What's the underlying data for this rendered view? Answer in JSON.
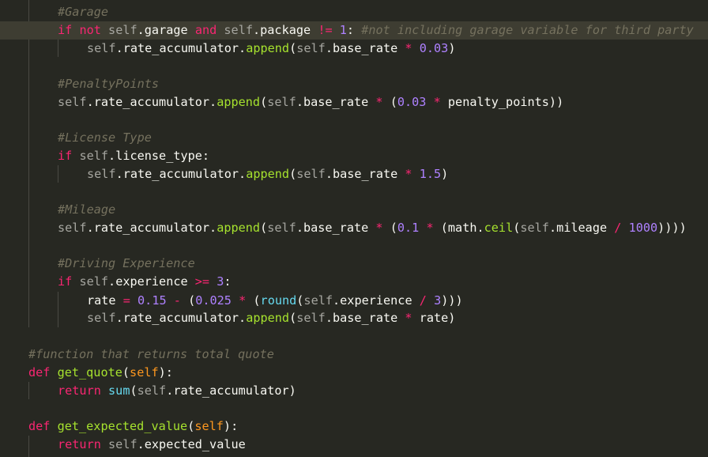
{
  "editor": {
    "theme": {
      "background": "#272822",
      "active_line": "#3e3d32",
      "comment": "#75715e",
      "keyword": "#f92672",
      "function": "#a6e22e",
      "number": "#ae81ff"
    },
    "lines": [
      {
        "tokens": [
          [
            "comment",
            "#Garage"
          ]
        ]
      },
      {
        "tokens": [
          [
            "kw",
            "if"
          ],
          [
            "punc",
            " "
          ],
          [
            "kw",
            "not"
          ],
          [
            "punc",
            " "
          ],
          [
            "self",
            "self"
          ],
          [
            "punc",
            "."
          ],
          [
            "attr",
            "garage"
          ],
          [
            "punc",
            " "
          ],
          [
            "kw",
            "and"
          ],
          [
            "punc",
            " "
          ],
          [
            "self",
            "self"
          ],
          [
            "punc",
            "."
          ],
          [
            "attr",
            "package"
          ],
          [
            "punc",
            " "
          ],
          [
            "op",
            "!="
          ],
          [
            "punc",
            " "
          ],
          [
            "num",
            "1"
          ],
          [
            "punc",
            ": "
          ],
          [
            "comment",
            "#not including garage variable for third party"
          ]
        ]
      },
      {
        "tokens": [
          [
            "self",
            "self"
          ],
          [
            "punc",
            "."
          ],
          [
            "attr",
            "rate_accumulator"
          ],
          [
            "punc",
            "."
          ],
          [
            "fn",
            "append"
          ],
          [
            "punc",
            "("
          ],
          [
            "self",
            "self"
          ],
          [
            "punc",
            "."
          ],
          [
            "attr",
            "base_rate"
          ],
          [
            "punc",
            " "
          ],
          [
            "op",
            "*"
          ],
          [
            "punc",
            " "
          ],
          [
            "num",
            "0.03"
          ],
          [
            "punc",
            ")"
          ]
        ]
      },
      {
        "tokens": []
      },
      {
        "tokens": [
          [
            "comment",
            "#PenaltyPoints"
          ]
        ]
      },
      {
        "tokens": [
          [
            "self",
            "self"
          ],
          [
            "punc",
            "."
          ],
          [
            "attr",
            "rate_accumulator"
          ],
          [
            "punc",
            "."
          ],
          [
            "fn",
            "append"
          ],
          [
            "punc",
            "("
          ],
          [
            "self",
            "self"
          ],
          [
            "punc",
            "."
          ],
          [
            "attr",
            "base_rate"
          ],
          [
            "punc",
            " "
          ],
          [
            "op",
            "*"
          ],
          [
            "punc",
            " ("
          ],
          [
            "num",
            "0.03"
          ],
          [
            "punc",
            " "
          ],
          [
            "op",
            "*"
          ],
          [
            "punc",
            " penalty_points))"
          ]
        ]
      },
      {
        "tokens": []
      },
      {
        "tokens": [
          [
            "comment",
            "#License Type"
          ]
        ]
      },
      {
        "tokens": [
          [
            "kw",
            "if"
          ],
          [
            "punc",
            " "
          ],
          [
            "self",
            "self"
          ],
          [
            "punc",
            "."
          ],
          [
            "attr",
            "license_type"
          ],
          [
            "punc",
            ":"
          ]
        ]
      },
      {
        "tokens": [
          [
            "self",
            "self"
          ],
          [
            "punc",
            "."
          ],
          [
            "attr",
            "rate_accumulator"
          ],
          [
            "punc",
            "."
          ],
          [
            "fn",
            "append"
          ],
          [
            "punc",
            "("
          ],
          [
            "self",
            "self"
          ],
          [
            "punc",
            "."
          ],
          [
            "attr",
            "base_rate"
          ],
          [
            "punc",
            " "
          ],
          [
            "op",
            "*"
          ],
          [
            "punc",
            " "
          ],
          [
            "num",
            "1.5"
          ],
          [
            "punc",
            ")"
          ]
        ]
      },
      {
        "tokens": []
      },
      {
        "tokens": [
          [
            "comment",
            "#Mileage"
          ]
        ]
      },
      {
        "tokens": [
          [
            "self",
            "self"
          ],
          [
            "punc",
            "."
          ],
          [
            "attr",
            "rate_accumulator"
          ],
          [
            "punc",
            "."
          ],
          [
            "fn",
            "append"
          ],
          [
            "punc",
            "("
          ],
          [
            "self",
            "self"
          ],
          [
            "punc",
            "."
          ],
          [
            "attr",
            "base_rate"
          ],
          [
            "punc",
            " "
          ],
          [
            "op",
            "*"
          ],
          [
            "punc",
            " ("
          ],
          [
            "num",
            "0.1"
          ],
          [
            "punc",
            " "
          ],
          [
            "op",
            "*"
          ],
          [
            "punc",
            " (math."
          ],
          [
            "fn",
            "ceil"
          ],
          [
            "punc",
            "("
          ],
          [
            "self",
            "self"
          ],
          [
            "punc",
            "."
          ],
          [
            "attr",
            "mileage"
          ],
          [
            "punc",
            " "
          ],
          [
            "op",
            "/"
          ],
          [
            "punc",
            " "
          ],
          [
            "num",
            "1000"
          ],
          [
            "punc",
            "))))"
          ]
        ]
      },
      {
        "tokens": []
      },
      {
        "tokens": [
          [
            "comment",
            "#Driving Experience"
          ]
        ]
      },
      {
        "tokens": [
          [
            "kw",
            "if"
          ],
          [
            "punc",
            " "
          ],
          [
            "self",
            "self"
          ],
          [
            "punc",
            "."
          ],
          [
            "attr",
            "experience"
          ],
          [
            "punc",
            " "
          ],
          [
            "op",
            ">="
          ],
          [
            "punc",
            " "
          ],
          [
            "num",
            "3"
          ],
          [
            "punc",
            ":"
          ]
        ]
      },
      {
        "tokens": [
          [
            "punc",
            "rate "
          ],
          [
            "op",
            "="
          ],
          [
            "punc",
            " "
          ],
          [
            "num",
            "0.15"
          ],
          [
            "punc",
            " "
          ],
          [
            "op",
            "-"
          ],
          [
            "punc",
            " ("
          ],
          [
            "num",
            "0.025"
          ],
          [
            "punc",
            " "
          ],
          [
            "op",
            "*"
          ],
          [
            "punc",
            " ("
          ],
          [
            "builtin",
            "round"
          ],
          [
            "punc",
            "("
          ],
          [
            "self",
            "self"
          ],
          [
            "punc",
            "."
          ],
          [
            "attr",
            "experience"
          ],
          [
            "punc",
            " "
          ],
          [
            "op",
            "/"
          ],
          [
            "punc",
            " "
          ],
          [
            "num",
            "3"
          ],
          [
            "punc",
            ")))"
          ]
        ]
      },
      {
        "tokens": [
          [
            "self",
            "self"
          ],
          [
            "punc",
            "."
          ],
          [
            "attr",
            "rate_accumulator"
          ],
          [
            "punc",
            "."
          ],
          [
            "fn",
            "append"
          ],
          [
            "punc",
            "("
          ],
          [
            "self",
            "self"
          ],
          [
            "punc",
            "."
          ],
          [
            "attr",
            "base_rate"
          ],
          [
            "punc",
            " "
          ],
          [
            "op",
            "*"
          ],
          [
            "punc",
            " rate)"
          ]
        ]
      },
      {
        "tokens": []
      },
      {
        "tokens": [
          [
            "comment",
            "#function that returns total quote"
          ]
        ]
      },
      {
        "tokens": [
          [
            "kw",
            "def"
          ],
          [
            "punc",
            " "
          ],
          [
            "fn",
            "get_quote"
          ],
          [
            "punc",
            "("
          ],
          [
            "param",
            "self"
          ],
          [
            "punc",
            "):"
          ]
        ]
      },
      {
        "tokens": [
          [
            "kw",
            "return"
          ],
          [
            "punc",
            " "
          ],
          [
            "builtin",
            "sum"
          ],
          [
            "punc",
            "("
          ],
          [
            "self",
            "self"
          ],
          [
            "punc",
            "."
          ],
          [
            "attr",
            "rate_accumulator"
          ],
          [
            "punc",
            ")"
          ]
        ]
      },
      {
        "tokens": []
      },
      {
        "tokens": [
          [
            "kw",
            "def"
          ],
          [
            "punc",
            " "
          ],
          [
            "fn",
            "get_expected_value"
          ],
          [
            "punc",
            "("
          ],
          [
            "param",
            "self"
          ],
          [
            "punc",
            "):"
          ]
        ]
      },
      {
        "tokens": [
          [
            "kw",
            "return"
          ],
          [
            "punc",
            " "
          ],
          [
            "self",
            "self"
          ],
          [
            "punc",
            "."
          ],
          [
            "attr",
            "expected_value"
          ]
        ]
      }
    ]
  }
}
